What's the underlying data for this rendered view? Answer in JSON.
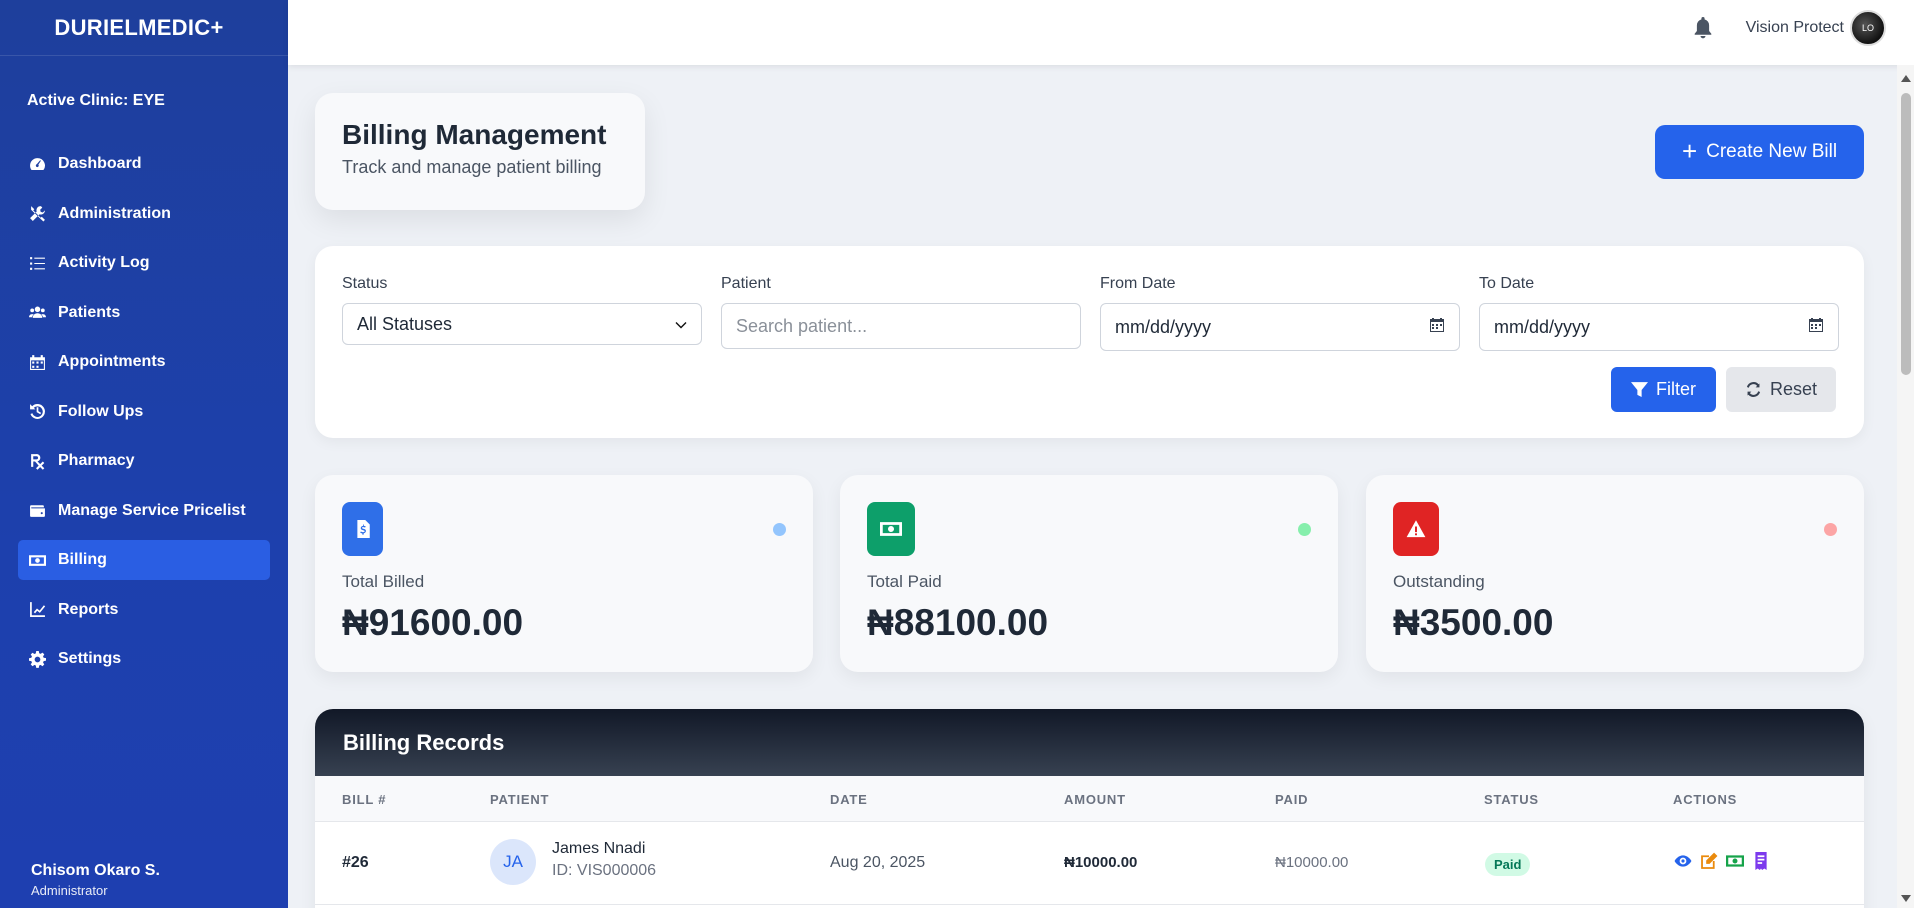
{
  "sidebar": {
    "brand": "DURIELMEDIC+",
    "active_clinic": "Active Clinic: EYE",
    "items": [
      {
        "label": "Dashboard",
        "icon": "gauge-icon"
      },
      {
        "label": "Administration",
        "icon": "tools-icon"
      },
      {
        "label": "Activity Log",
        "icon": "list-icon"
      },
      {
        "label": "Patients",
        "icon": "users-icon"
      },
      {
        "label": "Appointments",
        "icon": "calendar-icon"
      },
      {
        "label": "Follow Ups",
        "icon": "history-icon"
      },
      {
        "label": "Pharmacy",
        "icon": "prescription-icon"
      },
      {
        "label": "Manage Service Pricelist",
        "icon": "wallet-icon"
      },
      {
        "label": "Billing",
        "icon": "money-icon",
        "active": true
      },
      {
        "label": "Reports",
        "icon": "chart-line-icon"
      },
      {
        "label": "Settings",
        "icon": "gear-icon"
      }
    ],
    "user": {
      "name": "Chisom Okaro S.",
      "role": "Administrator"
    }
  },
  "topbar": {
    "user_name": "Vision Protect",
    "avatar_text": "LO"
  },
  "header": {
    "title": "Billing Management",
    "subtitle": "Track and manage patient billing",
    "create_button": "Create New Bill"
  },
  "filters": {
    "status_label": "Status",
    "status_value": "All Statuses",
    "patient_label": "Patient",
    "patient_placeholder": "Search patient...",
    "from_label": "From Date",
    "from_placeholder": "mm/dd/yyyy",
    "to_label": "To Date",
    "to_placeholder": "mm/dd/yyyy",
    "filter_button": "Filter",
    "reset_button": "Reset"
  },
  "stats": [
    {
      "label": "Total Billed",
      "value": "₦91600.00",
      "color": "#2f6fe8",
      "dot": "#93c5fd"
    },
    {
      "label": "Total Paid",
      "value": "₦88100.00",
      "color": "#0d9f6a",
      "dot": "#86efac"
    },
    {
      "label": "Outstanding",
      "value": "₦3500.00",
      "color": "#e02424",
      "dot": "#fca5a5"
    }
  ],
  "records": {
    "title": "Billing Records",
    "columns": [
      "BILL #",
      "PATIENT",
      "DATE",
      "AMOUNT",
      "PAID",
      "STATUS",
      "ACTIONS"
    ],
    "rows": [
      {
        "bill": "#26",
        "initials": "JA",
        "patient": "James Nnadi",
        "patient_id": "ID: VIS000006",
        "date": "Aug 20, 2025",
        "amount": "₦10000.00",
        "paid": "₦10000.00",
        "status": "Paid"
      }
    ]
  }
}
